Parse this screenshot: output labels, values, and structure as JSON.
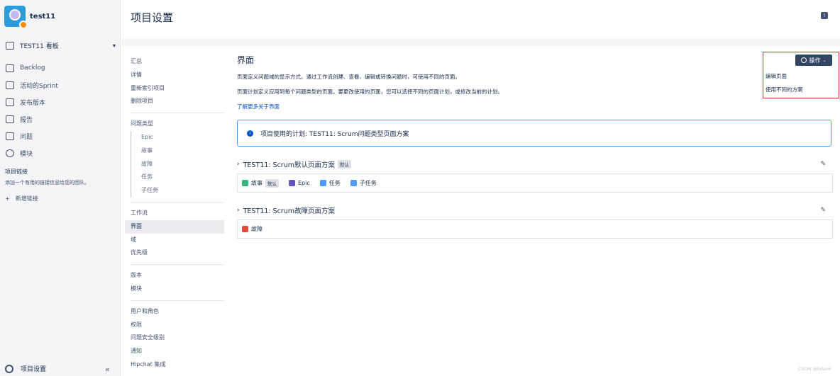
{
  "project": {
    "name": "test11"
  },
  "sidebar": {
    "board": "TEST11 看板",
    "items": [
      {
        "label": "Backlog",
        "icon": "backlog-icon"
      },
      {
        "label": "活动的Sprint",
        "icon": "board-icon"
      },
      {
        "label": "发布版本",
        "icon": "ship-icon"
      },
      {
        "label": "报告",
        "icon": "chart-icon"
      },
      {
        "label": "问题",
        "icon": "issues-icon"
      },
      {
        "label": "模块",
        "icon": "component-icon"
      }
    ],
    "project_links_title": "项目链接",
    "project_links_desc": "添加一个有用的链接信息给您的团队。",
    "add_link": "新增链接",
    "add_link_icon": "+",
    "settings": "项目设置",
    "collapse_icon": "«"
  },
  "header": {
    "title": "项目设置",
    "feedback_icon": "!"
  },
  "subnav": {
    "g1": [
      "汇总",
      "详情",
      "重新索引项目",
      "删除项目"
    ],
    "issue_types": "问题类型",
    "issue_type_children": [
      "Epic",
      "故事",
      "故障",
      "任务",
      "子任务"
    ],
    "g3": [
      "工作流",
      "界面",
      "域",
      "优先级"
    ],
    "g4": [
      "版本",
      "模块"
    ],
    "g5": [
      "用户和角色",
      "权限",
      "问题安全级别",
      "通知",
      "Hipchat 集成"
    ]
  },
  "main": {
    "title": "界面",
    "desc1": "页面定义问题域的显示方式。通过工作流创建、查看、编辑或转换问题时，可使用不同的页面。",
    "desc2": "页面计划定义应用到每个问题类型的页面。要更改使用的页面，您可以选择不同的页面计划，或修改当前的计划。",
    "learn_more": "了解更多关于界面",
    "info_icon": "i",
    "info": "项目使用的计划: TEST11: Scrum问题类型页面方案",
    "schemes": [
      {
        "name": "TEST11: Scrum默认页面方案",
        "badge": "默认",
        "types": [
          {
            "label": "故事",
            "badge": "默认",
            "color": "#36b37e"
          },
          {
            "label": "Epic",
            "color": "#6554c0"
          },
          {
            "label": "任务",
            "color": "#4c9aff"
          },
          {
            "label": "子任务",
            "color": "#4c9aff"
          }
        ]
      },
      {
        "name": "TEST11: Scrum故障页面方案",
        "types": [
          {
            "label": "故障",
            "color": "#e5493a"
          }
        ]
      }
    ],
    "expand_icon": "›",
    "edit_icon": "✎"
  },
  "actions": {
    "button": "操作",
    "chevron": "⌄",
    "menu": [
      "编辑页面",
      "使用不同的方案"
    ]
  },
  "watermark": "CSDN @lidaoo"
}
